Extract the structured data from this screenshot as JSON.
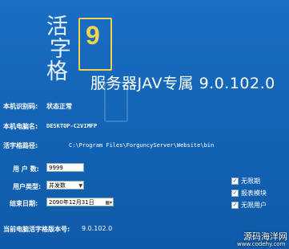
{
  "logo": {
    "chars": [
      "活",
      "字",
      "格"
    ],
    "version_digit": "9"
  },
  "product_title": "服务器JAV专属 9.0.102.0",
  "info": {
    "machine_id_label": "本机识别码:",
    "machine_id_value": "状态正常",
    "computer_name_label": "本机电脑名:",
    "computer_name_value": "DESKTOP-C2VIMFP",
    "path_label": "活字格路径:",
    "path_value": "C:\\Program Files\\ForguncyServer\\Website\\bin"
  },
  "form": {
    "users_label": "用 户 数:",
    "users_value": "9999",
    "user_type_label": "用户类型:",
    "user_type_value": "并发数",
    "end_date_label": "结束日期:",
    "end_date_value": "2090年12月31日"
  },
  "options": [
    {
      "label": "无限期",
      "checked": true
    },
    {
      "label": "报表模块",
      "checked": true
    },
    {
      "label": "无限用户",
      "checked": true
    }
  ],
  "current_version_label": "当前电脑活字格版本号:",
  "current_version_value": "9.0.102.0",
  "watermark": {
    "line1": "源码海洋网",
    "line2": "www.codehy.com"
  }
}
